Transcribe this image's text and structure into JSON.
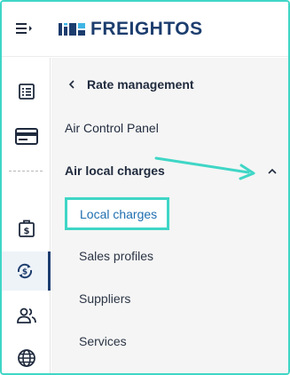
{
  "app": {
    "logo_text": "FREIGHTOS",
    "accent_color": "#3fd6c6",
    "brand_color": "#1c3d6e"
  },
  "rail": {
    "items": [
      {
        "icon": "list-icon"
      },
      {
        "icon": "credit-card-icon"
      },
      {
        "icon": "price-tag-icon"
      },
      {
        "icon": "rates-icon"
      },
      {
        "icon": "users-icon"
      },
      {
        "icon": "globe-icon"
      }
    ]
  },
  "panel": {
    "back_label": "Rate management",
    "air_control_panel": "Air Control Panel",
    "air_local_charges": "Air local charges",
    "sub_items": {
      "local_charges": "Local charges",
      "sales_profiles": "Sales profiles",
      "suppliers": "Suppliers",
      "services": "Services"
    }
  }
}
